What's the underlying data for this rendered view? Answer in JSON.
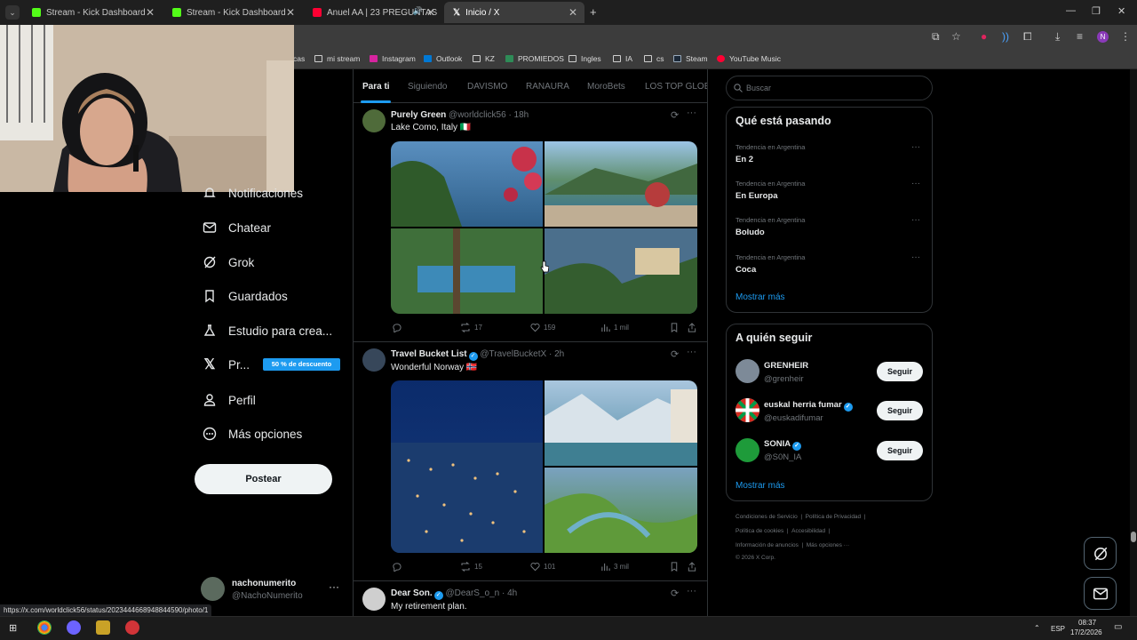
{
  "browser": {
    "tabs": [
      {
        "title": "Stream - Kick Dashboard",
        "favicon_color": "#53fc18"
      },
      {
        "title": "Stream - Kick Dashboard",
        "favicon_color": "#53fc18"
      },
      {
        "title": "Anuel AA | 23 PREGUNTAS",
        "favicon_color": "#ff0033"
      },
      {
        "title": "Inicio / X",
        "favicon_color": "#ffffff"
      }
    ],
    "bookmarks": [
      "cas",
      "mi stream",
      "Instagram",
      "Outlook",
      "KZ",
      "PROMIEDOS",
      "Ingles",
      "IA",
      "cs",
      "Steam",
      "YouTube Music"
    ],
    "profile_initial": "N",
    "status_url": "https://x.com/worldclick56/status/2023444668948844590/photo/1"
  },
  "sidebar": {
    "items": [
      {
        "label": "Notificaciones",
        "icon": "bell-icon"
      },
      {
        "label": "Chatear",
        "icon": "mail-icon"
      },
      {
        "label": "Grok",
        "icon": "grok-icon"
      },
      {
        "label": "Guardados",
        "icon": "bookmark-icon"
      },
      {
        "label": "Estudio para crea...",
        "icon": "flask-icon"
      },
      {
        "label": "Pr...",
        "icon": "x-logo-icon"
      },
      {
        "label": "Perfil",
        "icon": "person-icon"
      },
      {
        "label": "Más opciones",
        "icon": "more-circle-icon"
      }
    ],
    "promo_badge": "50 % de descuento",
    "post_button": "Postear",
    "account": {
      "name": "nachonumerito",
      "handle": "@NachoNumerito",
      "more": "···"
    }
  },
  "feed": {
    "tabs": [
      "Para ti",
      "Siguiendo",
      "DAVISMO",
      "RANAURA",
      "MoroBets",
      "LOS TOP GLOBA"
    ],
    "posts": [
      {
        "name": "Purely Green",
        "handle": "@worldclick56 · 18h",
        "verified": false,
        "text": "Lake Como, Italy 🇮🇹",
        "replies": "",
        "reposts": "17",
        "likes": "159",
        "views": "1 mil"
      },
      {
        "name": "Travel Bucket List",
        "handle": "@TravelBucketX · 2h",
        "verified": true,
        "text": "Wonderful Norway 🇳🇴",
        "replies": "",
        "reposts": "15",
        "likes": "101",
        "views": "3 mil"
      },
      {
        "name": "Dear Son.",
        "handle": "@DearS_o_n · 4h",
        "verified": true,
        "text": "My retirement plan."
      }
    ]
  },
  "right": {
    "search_placeholder": "Buscar",
    "trends_title": "Qué está pasando",
    "trends": [
      {
        "context": "Tendencia en Argentina",
        "name": "En 2"
      },
      {
        "context": "Tendencia en Argentina",
        "name": "En Europa"
      },
      {
        "context": "Tendencia en Argentina",
        "name": "Boludo"
      },
      {
        "context": "Tendencia en Argentina",
        "name": "Coca"
      }
    ],
    "trends_more": "Mostrar más",
    "follow_title": "A quién seguir",
    "follow": [
      {
        "name": "GRENHEIR",
        "handle": "@grenheir",
        "verified": false,
        "button": "Seguir"
      },
      {
        "name": "euskal herria fumar",
        "handle": "@euskadifumar",
        "verified": true,
        "button": "Seguir"
      },
      {
        "name": "SONIA",
        "handle": "@S0N_IA",
        "verified": true,
        "button": "Seguir"
      }
    ],
    "follow_more": "Mostrar más",
    "footer": {
      "line1a": "Condiciones de Servicio",
      "line1b": "Política de Privacidad",
      "line2a": "Política de cookies",
      "line2b": "Accesibilidad",
      "line3a": "Información de anuncios",
      "line3b": "Más opciones ···",
      "copyright": "© 2026 X Corp."
    }
  },
  "taskbar": {
    "lang": "ESP",
    "time": "08:37",
    "date": "17/2/2026"
  },
  "colors": {
    "accent": "#1d9bf0",
    "background": "#000000",
    "border": "#2f3336",
    "muted": "#71767b"
  }
}
